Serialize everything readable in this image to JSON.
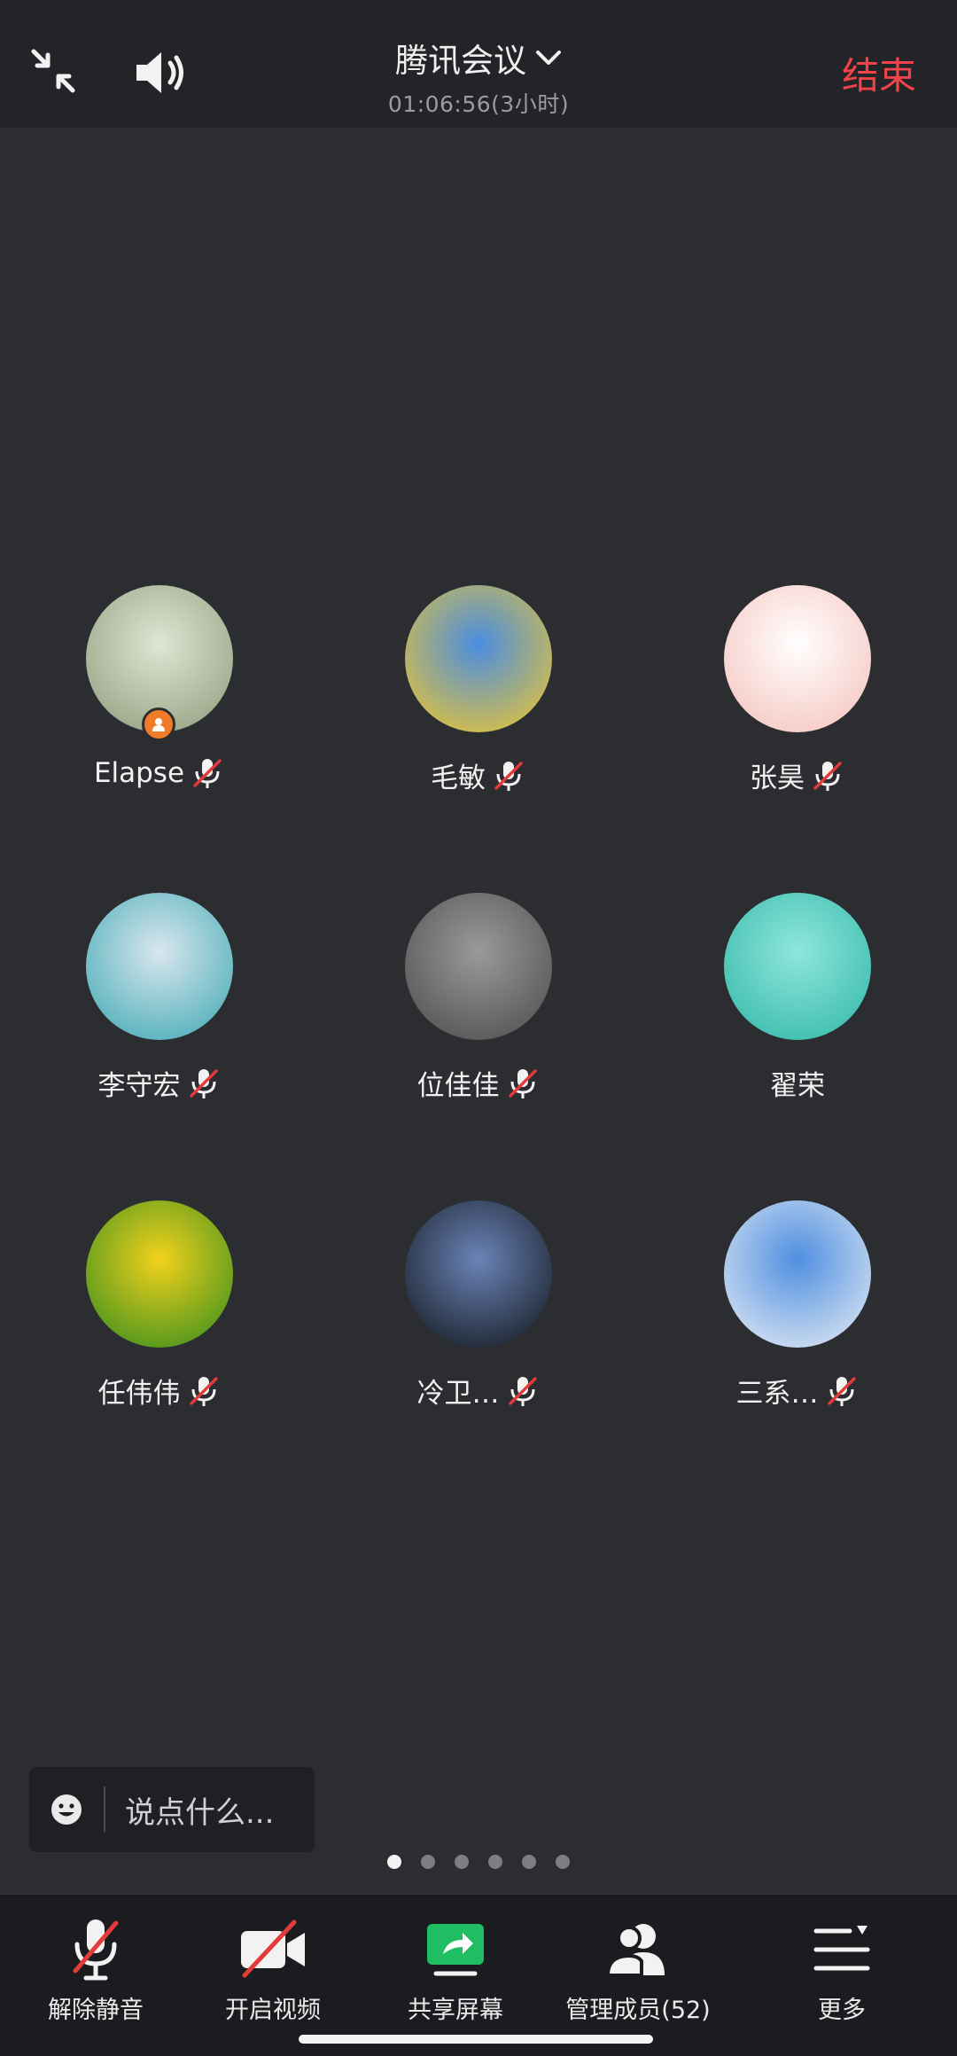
{
  "topbar": {
    "title": "腾讯会议",
    "subtitle": "01:06:56(3小时)",
    "end_label": "结束"
  },
  "participants": [
    {
      "name": "Elapse",
      "muted": true,
      "host": true,
      "avatar_colors": [
        "#dfe6d3",
        "#8c9a7a"
      ],
      "avatar_icon": "husky-puppy-photo"
    },
    {
      "name": "毛敏",
      "muted": true,
      "host": false,
      "avatar_colors": [
        "#4a8de0",
        "#f3c82a"
      ],
      "avatar_icon": "sunflower-photo"
    },
    {
      "name": "张昊",
      "muted": true,
      "host": false,
      "avatar_colors": [
        "#ffffff",
        "#f4c0b9"
      ],
      "avatar_icon": "cartoon-kids"
    },
    {
      "name": "李守宏",
      "muted": true,
      "host": false,
      "avatar_colors": [
        "#d9e6ee",
        "#3aa7b2"
      ],
      "avatar_icon": "sea-photo"
    },
    {
      "name": "位佳佳",
      "muted": true,
      "host": false,
      "avatar_colors": [
        "#9a9a9a",
        "#4a4a4a"
      ],
      "avatar_icon": "fog-photo"
    },
    {
      "name": "翟荣",
      "muted": false,
      "host": false,
      "avatar_colors": [
        "#8fe6dc",
        "#2fb6a6"
      ],
      "avatar_icon": "white-flower-photo"
    },
    {
      "name": "任伟伟",
      "muted": true,
      "host": false,
      "avatar_colors": [
        "#f2d21c",
        "#2d8a1e"
      ],
      "avatar_icon": "pixel-flower"
    },
    {
      "name": "冷卫…",
      "muted": true,
      "host": false,
      "avatar_colors": [
        "#6a84b8",
        "#101418"
      ],
      "avatar_icon": "sunset-photo"
    },
    {
      "name": "三系…",
      "muted": true,
      "host": false,
      "avatar_colors": [
        "#4f8fe0",
        "#e9eef5"
      ],
      "avatar_icon": "hot-air-balloons-photo"
    }
  ],
  "chat": {
    "placeholder": "说点什么..."
  },
  "pager": {
    "count": 6,
    "active": 0
  },
  "bottombar": {
    "unmute_label": "解除静音",
    "video_label": "开启视频",
    "share_label": "共享屏幕",
    "members_label": "管理成员(52)",
    "more_label": "更多"
  },
  "colors": {
    "accent_red": "#f0444a",
    "share_green": "#1fbe63",
    "host_orange": "#f07c2a"
  }
}
